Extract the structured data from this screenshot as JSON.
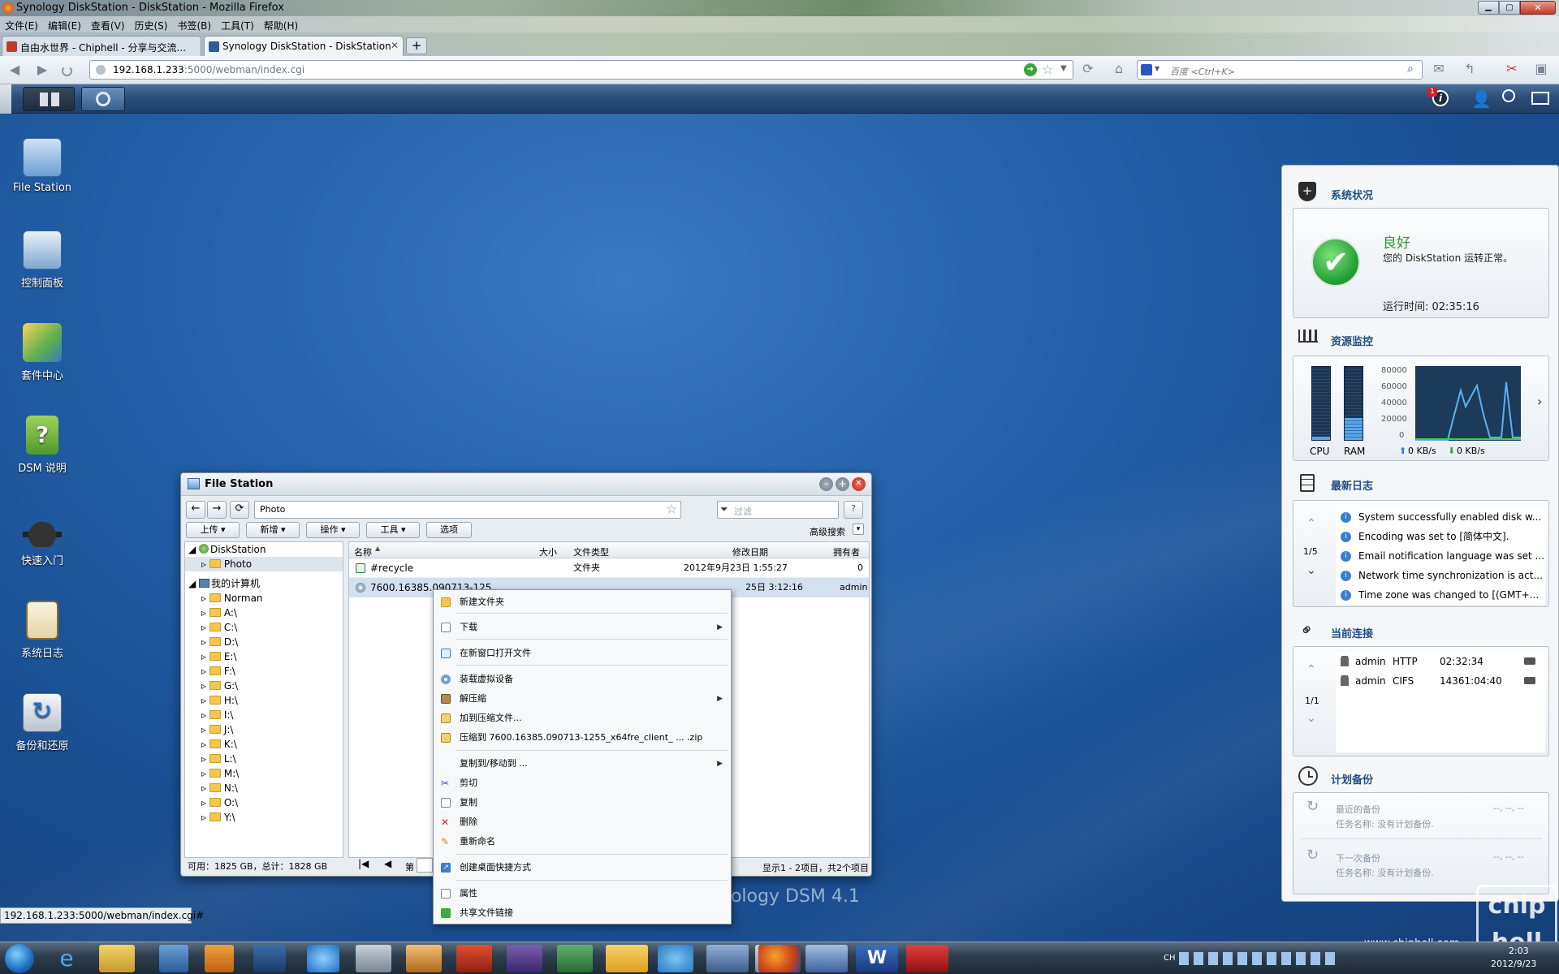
{
  "window": {
    "title": "Synology DiskStation - DiskStation - Mozilla Firefox"
  },
  "menu": [
    "文件(E)",
    "编辑(E)",
    "查看(V)",
    "历史(S)",
    "书签(B)",
    "工具(T)",
    "帮助(H)"
  ],
  "tabs": [
    {
      "label": "自由水世界 - Chiphell - 分享与交流..."
    },
    {
      "label": "Synology DiskStation - DiskStation"
    }
  ],
  "url": {
    "host": "192.168.1.233",
    "rest": ":5000/webman/index.cgi"
  },
  "search": {
    "placeholder": "百度 <Ctrl+K>"
  },
  "notification_count": "1",
  "desktop_icons": [
    "File Station",
    "控制面板",
    "套件中心",
    "DSM 说明",
    "快速入门",
    "系统日志",
    "备份和还原"
  ],
  "widgets": {
    "status": {
      "title": "系统状况",
      "state": "良好",
      "message": "您的 DiskStation 运转正常。",
      "uptime": "运行时间: 02:35:16"
    },
    "resource": {
      "title": "资源监控",
      "cpu": "CPU",
      "ram": "RAM",
      "cpu_level": 0.05,
      "ram_level": 0.3,
      "yticks": [
        "80000",
        "60000",
        "40000",
        "20000",
        "0"
      ],
      "up": "0 KB/s",
      "down": "0 KB/s"
    },
    "logs": {
      "title": "最新日志",
      "pager": "1/5",
      "items": [
        "System successfully enabled disk w...",
        "Encoding was set to [简体中文].",
        "Email notification language was set ...",
        "Network time synchronization is act...",
        "Time zone was changed to [(GMT+..."
      ]
    },
    "connections": {
      "title": "当前连接",
      "pager": "1/1",
      "rows": [
        {
          "user": "admin",
          "proto": "HTTP",
          "time": "02:32:34"
        },
        {
          "user": "admin",
          "proto": "CIFS",
          "time": "14361:04:40"
        }
      ]
    },
    "backup": {
      "title": "计划备份",
      "last_label": "最近的备份",
      "last_task": "任务名称: 没有计划备份.",
      "next_label": "下一次备份",
      "next_task": "任务名称: 没有计划备份.",
      "dash": "--, --, --"
    }
  },
  "filestation": {
    "title": "File Station",
    "path": "Photo",
    "filter_placeholder": "过滤",
    "toolbar": [
      "上传",
      "新增",
      "操作",
      "工具",
      "选项"
    ],
    "advanced": "高级搜索",
    "tree": {
      "root": "DiskStation",
      "shared": [
        "Photo"
      ],
      "pc": "我的计算机",
      "drives": [
        "Norman",
        "A:\\",
        "C:\\",
        "D:\\",
        "E:\\",
        "F:\\",
        "G:\\",
        "H:\\",
        "I:\\",
        "J:\\",
        "K:\\",
        "L:\\",
        "M:\\",
        "N:\\",
        "O:\\",
        "Y:\\"
      ]
    },
    "columns": [
      "名称",
      "大小",
      "文件类型",
      "修改日期",
      "拥有者"
    ],
    "rows": [
      {
        "name": "#recycle",
        "size": "",
        "type": "文件夹",
        "date": "2012年9月23日 1:55:27",
        "owner": "0"
      },
      {
        "name": "7600.16385.090713-125",
        "size": "",
        "type": "",
        "date": "25日 3:12:16",
        "owner": "admin"
      }
    ],
    "disk": "可用：1825 GB，总计：1828 GB",
    "page_label": "第",
    "page_info": "显示1 - 2项目，共2个项目"
  },
  "context_menu": [
    "新建文件夹",
    "下载",
    "在新窗口打开文件",
    "装载虚拟设备",
    "解压缩",
    "加到压缩文件...",
    "压缩到 7600.16385.090713-1255_x64fre_client_ ... .zip",
    "复制到/移动到 ...",
    "剪切",
    "复制",
    "删除",
    "重新命名",
    "创建桌面快捷方式",
    "属性",
    "共享文件链接"
  ],
  "watermark": "nology DSM 4.1",
  "status_url": "192.168.1.233:5000/webman/index.cgi#",
  "clock": {
    "time": "2:03",
    "date": "2012/9/23"
  },
  "site_watermark": "www.chiphell.com",
  "ime": "CH"
}
